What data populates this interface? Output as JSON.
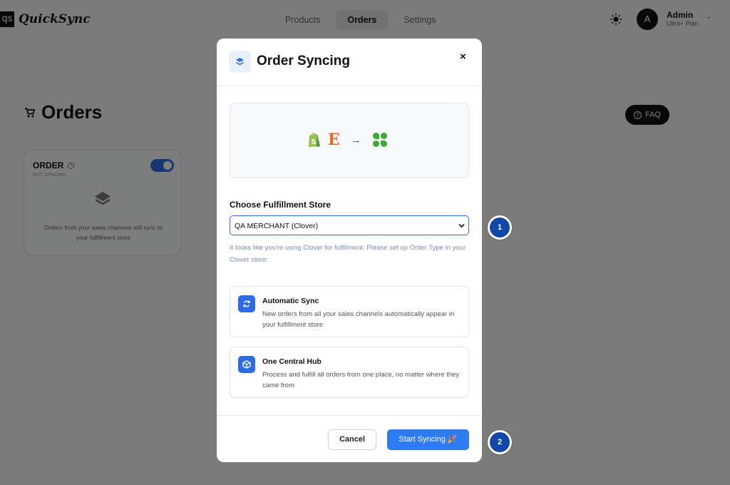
{
  "app": {
    "logo_mark": "qs",
    "logo_text": "QuickSync"
  },
  "nav": {
    "items": [
      {
        "label": "Products"
      },
      {
        "label": "Orders"
      },
      {
        "label": "Settings"
      }
    ],
    "active": "Orders"
  },
  "user": {
    "avatar_letter": "A",
    "name": "Admin",
    "plan": "Ultra+ Plan"
  },
  "page": {
    "title": "Orders",
    "faq_label": "FAQ"
  },
  "order_card": {
    "title": "ORDER",
    "status": "NOT SYNCING",
    "toggle_on": true,
    "description": "Orders from your sales channels will sync to your fulfillment store"
  },
  "modal": {
    "title": "Order Syncing",
    "close_label": "×",
    "flow": {
      "sources": [
        "shopify-icon",
        "etsy-icon"
      ],
      "etsy_letter": "E",
      "arrow": "→",
      "target": "clover-icon"
    },
    "store_label": "Choose Fulfillment Store",
    "store_value": "QA MERCHANT (Clover)",
    "clover_hint": "It looks like you're using Clover for fulfillment. Please set up Order Type in your Clover store:",
    "features": [
      {
        "title": "Automatic Sync",
        "description": "New orders from all your sales channels automatically appear in your fulfillment store",
        "icon": "sync-icon"
      },
      {
        "title": "One Central Hub",
        "description": "Process and fulfill all orders from one place, no matter where they came from",
        "icon": "cube-icon"
      }
    ],
    "cancel_label": "Cancel",
    "start_label": "Start Syncing 🎉"
  },
  "step_markers": [
    "1",
    "2"
  ],
  "colors": {
    "accent": "#2d7cf6",
    "marker": "#1147a8",
    "hint": "#7a8fb3",
    "etsy": "#f1641e",
    "shopify": "#95bf47",
    "clover": "#3aaa35"
  }
}
